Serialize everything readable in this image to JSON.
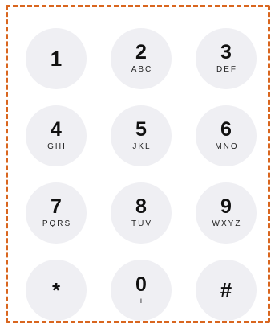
{
  "keypad": {
    "keys": [
      {
        "digit": "1",
        "letters": ""
      },
      {
        "digit": "2",
        "letters": "ABC"
      },
      {
        "digit": "3",
        "letters": "DEF"
      },
      {
        "digit": "4",
        "letters": "GHI"
      },
      {
        "digit": "5",
        "letters": "JKL"
      },
      {
        "digit": "6",
        "letters": "MNO"
      },
      {
        "digit": "7",
        "letters": "PQRS"
      },
      {
        "digit": "8",
        "letters": "TUV"
      },
      {
        "digit": "9",
        "letters": "WXYZ"
      },
      {
        "digit": "*",
        "letters": ""
      },
      {
        "digit": "0",
        "letters": "+"
      },
      {
        "digit": "#",
        "letters": ""
      }
    ]
  },
  "colors": {
    "frame_border": "#d9661f",
    "key_background": "#efeff3",
    "text": "#111111"
  }
}
